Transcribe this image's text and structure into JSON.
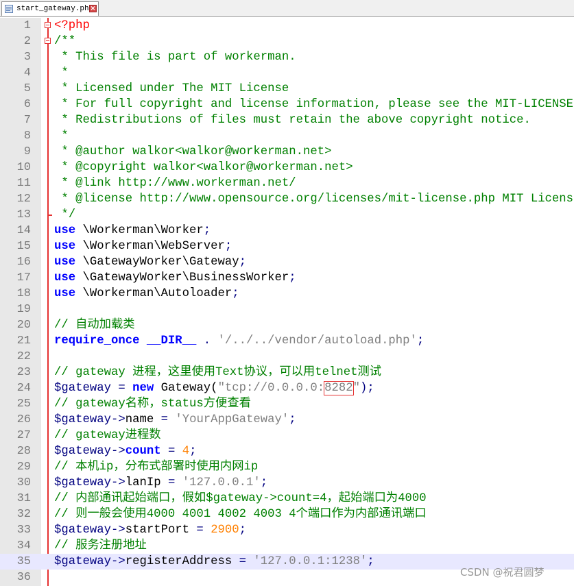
{
  "tab": {
    "label": "start_gateway.php",
    "icon": "php-file-icon",
    "close_glyph": "×"
  },
  "watermark": "CSDN @祝君圆梦",
  "lines": [
    {
      "n": "1",
      "parts": [
        {
          "t": "<?php",
          "c": "tag"
        }
      ],
      "fold": "start"
    },
    {
      "n": "2",
      "parts": [
        {
          "t": "/**",
          "c": "cm"
        }
      ],
      "fold": "start"
    },
    {
      "n": "3",
      "parts": [
        {
          "t": " * This file is part of workerman.",
          "c": "cm"
        }
      ]
    },
    {
      "n": "4",
      "parts": [
        {
          "t": " *",
          "c": "cm"
        }
      ]
    },
    {
      "n": "5",
      "parts": [
        {
          "t": " * Licensed under The MIT License",
          "c": "cm"
        }
      ]
    },
    {
      "n": "6",
      "parts": [
        {
          "t": " * For full copyright and license information, please see the MIT-LICENSE.txt",
          "c": "cm"
        }
      ]
    },
    {
      "n": "7",
      "parts": [
        {
          "t": " * Redistributions of files must retain the above copyright notice.",
          "c": "cm"
        }
      ]
    },
    {
      "n": "8",
      "parts": [
        {
          "t": " *",
          "c": "cm"
        }
      ]
    },
    {
      "n": "9",
      "parts": [
        {
          "t": " * @author walkor<walkor@workerman.net>",
          "c": "cm"
        }
      ]
    },
    {
      "n": "10",
      "parts": [
        {
          "t": " * @copyright walkor<walkor@workerman.net>",
          "c": "cm"
        }
      ]
    },
    {
      "n": "11",
      "parts": [
        {
          "t": " * @link http://www.workerman.net/",
          "c": "cm"
        }
      ]
    },
    {
      "n": "12",
      "parts": [
        {
          "t": " * @license http://www.opensource.org/licenses/mit-license.php MIT License",
          "c": "cm"
        }
      ]
    },
    {
      "n": "13",
      "parts": [
        {
          "t": " */",
          "c": "cm"
        }
      ],
      "fold": "end"
    },
    {
      "n": "14",
      "parts": [
        {
          "t": "use",
          "c": "kw"
        },
        {
          "t": " \\Workerman\\Worker",
          "c": ""
        },
        {
          "t": ";",
          "c": "op"
        }
      ]
    },
    {
      "n": "15",
      "parts": [
        {
          "t": "use",
          "c": "kw"
        },
        {
          "t": " \\Workerman\\WebServer",
          "c": ""
        },
        {
          "t": ";",
          "c": "op"
        }
      ]
    },
    {
      "n": "16",
      "parts": [
        {
          "t": "use",
          "c": "kw"
        },
        {
          "t": " \\GatewayWorker\\Gateway",
          "c": ""
        },
        {
          "t": ";",
          "c": "op"
        }
      ]
    },
    {
      "n": "17",
      "parts": [
        {
          "t": "use",
          "c": "kw"
        },
        {
          "t": " \\GatewayWorker\\BusinessWorker",
          "c": ""
        },
        {
          "t": ";",
          "c": "op"
        }
      ]
    },
    {
      "n": "18",
      "parts": [
        {
          "t": "use",
          "c": "kw"
        },
        {
          "t": " \\Workerman\\Autoloader",
          "c": ""
        },
        {
          "t": ";",
          "c": "op"
        }
      ]
    },
    {
      "n": "19",
      "parts": []
    },
    {
      "n": "20",
      "parts": [
        {
          "t": "// 自动加载类",
          "c": "cm"
        }
      ]
    },
    {
      "n": "21",
      "parts": [
        {
          "t": "require_once __DIR__",
          "c": "kw"
        },
        {
          "t": " . ",
          "c": "op"
        },
        {
          "t": "'/../../vendor/autoload.php'",
          "c": "str"
        },
        {
          "t": ";",
          "c": "op"
        }
      ]
    },
    {
      "n": "22",
      "parts": []
    },
    {
      "n": "23",
      "parts": [
        {
          "t": "// gateway 进程，这里使用Text协议，可以用telnet测试",
          "c": "cm"
        }
      ]
    },
    {
      "n": "24",
      "parts": [
        {
          "t": "$gateway",
          "c": "var"
        },
        {
          "t": " = ",
          "c": "op"
        },
        {
          "t": "new",
          "c": "kw"
        },
        {
          "t": " Gateway(",
          "c": ""
        },
        {
          "t": "\"tcp://0.0.0.0:",
          "c": "str"
        },
        {
          "t": "8282",
          "c": "str",
          "box": true
        },
        {
          "t": "\"",
          "c": "str"
        },
        {
          "t": ");",
          "c": "op"
        }
      ]
    },
    {
      "n": "25",
      "parts": [
        {
          "t": "// gateway名称，status方便查看",
          "c": "cm"
        }
      ]
    },
    {
      "n": "26",
      "parts": [
        {
          "t": "$gateway",
          "c": "var"
        },
        {
          "t": "->",
          "c": "op"
        },
        {
          "t": "name",
          "c": ""
        },
        {
          "t": " = ",
          "c": "op"
        },
        {
          "t": "'YourAppGateway'",
          "c": "str"
        },
        {
          "t": ";",
          "c": "op"
        }
      ]
    },
    {
      "n": "27",
      "parts": [
        {
          "t": "// gateway进程数",
          "c": "cm"
        }
      ]
    },
    {
      "n": "28",
      "parts": [
        {
          "t": "$gateway",
          "c": "var"
        },
        {
          "t": "->",
          "c": "op"
        },
        {
          "t": "count",
          "c": "kw"
        },
        {
          "t": " = ",
          "c": "op"
        },
        {
          "t": "4",
          "c": "num"
        },
        {
          "t": ";",
          "c": "op"
        }
      ]
    },
    {
      "n": "29",
      "parts": [
        {
          "t": "// 本机ip，分布式部署时使用内网ip",
          "c": "cm"
        }
      ]
    },
    {
      "n": "30",
      "parts": [
        {
          "t": "$gateway",
          "c": "var"
        },
        {
          "t": "->",
          "c": "op"
        },
        {
          "t": "lanIp",
          "c": ""
        },
        {
          "t": " = ",
          "c": "op"
        },
        {
          "t": "'127.0.0.1'",
          "c": "str"
        },
        {
          "t": ";",
          "c": "op"
        }
      ]
    },
    {
      "n": "31",
      "parts": [
        {
          "t": "// 内部通讯起始端口，假如$gateway->count=4，起始端口为4000",
          "c": "cm"
        }
      ]
    },
    {
      "n": "32",
      "parts": [
        {
          "t": "// 则一般会使用4000 4001 4002 4003 4个端口作为内部通讯端口",
          "c": "cm"
        }
      ]
    },
    {
      "n": "33",
      "parts": [
        {
          "t": "$gateway",
          "c": "var"
        },
        {
          "t": "->",
          "c": "op"
        },
        {
          "t": "startPort",
          "c": ""
        },
        {
          "t": " = ",
          "c": "op"
        },
        {
          "t": "2900",
          "c": "num"
        },
        {
          "t": ";",
          "c": "op"
        }
      ]
    },
    {
      "n": "34",
      "parts": [
        {
          "t": "// 服务注册地址",
          "c": "cm"
        }
      ]
    },
    {
      "n": "35",
      "parts": [
        {
          "t": "$gateway",
          "c": "var"
        },
        {
          "t": "->",
          "c": "op"
        },
        {
          "t": "registerAddress",
          "c": ""
        },
        {
          "t": " = ",
          "c": "op"
        },
        {
          "t": "'127.0.0.1:1238'",
          "c": "str"
        },
        {
          "t": ";",
          "c": "op"
        }
      ],
      "current": true
    },
    {
      "n": "36",
      "parts": []
    }
  ]
}
